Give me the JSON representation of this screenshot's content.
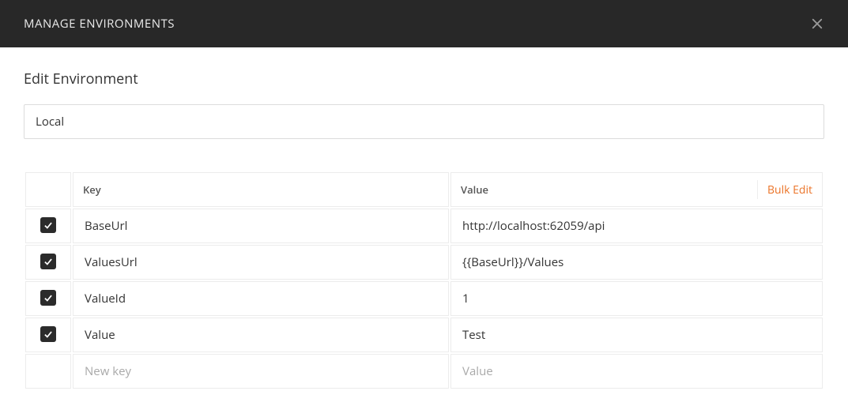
{
  "header": {
    "title": "MANAGE ENVIRONMENTS"
  },
  "section_title": "Edit Environment",
  "environment_name": "Local",
  "table": {
    "headers": {
      "key": "Key",
      "value": "Value"
    },
    "bulk_edit_label": "Bulk Edit",
    "rows": [
      {
        "checked": true,
        "key": "BaseUrl",
        "value": "http://localhost:62059/api"
      },
      {
        "checked": true,
        "key": "ValuesUrl",
        "value": "{{BaseUrl}}/Values"
      },
      {
        "checked": true,
        "key": "ValueId",
        "value": "1"
      },
      {
        "checked": true,
        "key": "Value",
        "value": "Test"
      }
    ],
    "placeholder": {
      "key": "New key",
      "value": "Value"
    }
  }
}
